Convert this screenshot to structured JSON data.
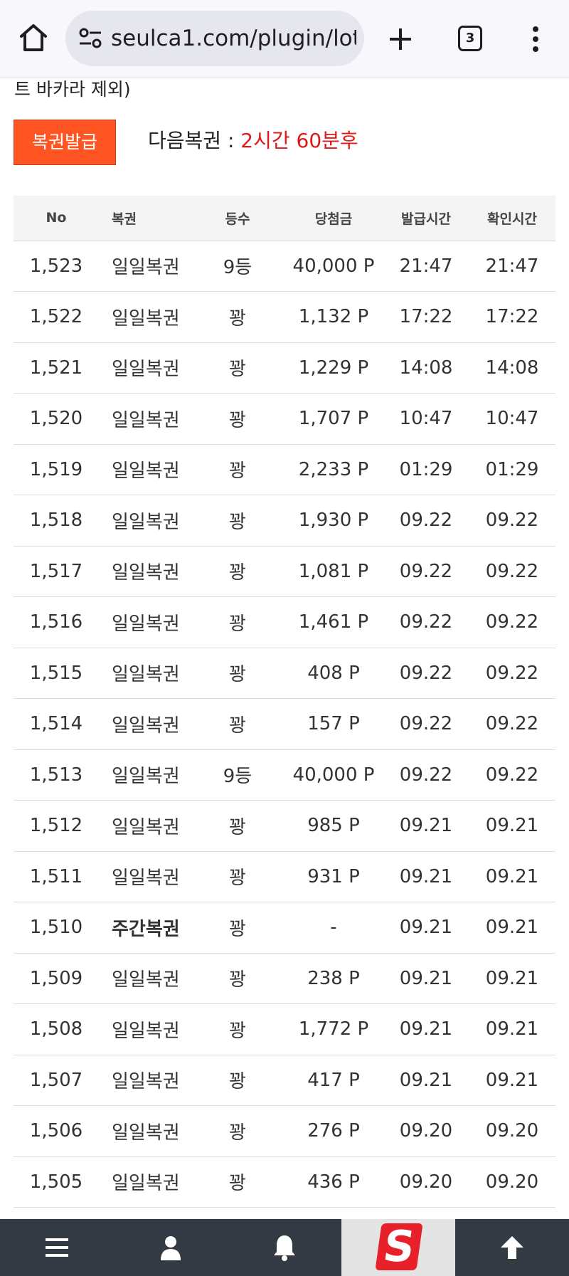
{
  "browser": {
    "url": "seulca1.com/plugin/lot",
    "tab_count": "3"
  },
  "page": {
    "notice_tail": "트 바카라 제외)",
    "issue_button": "복권발급",
    "next_label": "다음복권 : ",
    "next_value": "2시간 60분후"
  },
  "table": {
    "headers": [
      "No",
      "복권",
      "등수",
      "당첨금",
      "발급시간",
      "확인시간"
    ],
    "rows": [
      {
        "no": "1,523",
        "name": "일일복권",
        "rank": "9등",
        "prize": "40,000 P",
        "issued": "21:47",
        "checked": "21:47"
      },
      {
        "no": "1,522",
        "name": "일일복권",
        "rank": "꽝",
        "prize": "1,132 P",
        "issued": "17:22",
        "checked": "17:22"
      },
      {
        "no": "1,521",
        "name": "일일복권",
        "rank": "꽝",
        "prize": "1,229 P",
        "issued": "14:08",
        "checked": "14:08"
      },
      {
        "no": "1,520",
        "name": "일일복권",
        "rank": "꽝",
        "prize": "1,707 P",
        "issued": "10:47",
        "checked": "10:47"
      },
      {
        "no": "1,519",
        "name": "일일복권",
        "rank": "꽝",
        "prize": "2,233 P",
        "issued": "01:29",
        "checked": "01:29"
      },
      {
        "no": "1,518",
        "name": "일일복권",
        "rank": "꽝",
        "prize": "1,930 P",
        "issued": "09.22",
        "checked": "09.22"
      },
      {
        "no": "1,517",
        "name": "일일복권",
        "rank": "꽝",
        "prize": "1,081 P",
        "issued": "09.22",
        "checked": "09.22"
      },
      {
        "no": "1,516",
        "name": "일일복권",
        "rank": "꽝",
        "prize": "1,461 P",
        "issued": "09.22",
        "checked": "09.22"
      },
      {
        "no": "1,515",
        "name": "일일복권",
        "rank": "꽝",
        "prize": "408 P",
        "issued": "09.22",
        "checked": "09.22"
      },
      {
        "no": "1,514",
        "name": "일일복권",
        "rank": "꽝",
        "prize": "157 P",
        "issued": "09.22",
        "checked": "09.22"
      },
      {
        "no": "1,513",
        "name": "일일복권",
        "rank": "9등",
        "prize": "40,000 P",
        "issued": "09.22",
        "checked": "09.22"
      },
      {
        "no": "1,512",
        "name": "일일복권",
        "rank": "꽝",
        "prize": "985 P",
        "issued": "09.21",
        "checked": "09.21"
      },
      {
        "no": "1,511",
        "name": "일일복권",
        "rank": "꽝",
        "prize": "931 P",
        "issued": "09.21",
        "checked": "09.21"
      },
      {
        "no": "1,510",
        "name": "주간복권",
        "rank": "꽝",
        "prize": "-",
        "issued": "09.21",
        "checked": "09.21",
        "bold": true
      },
      {
        "no": "1,509",
        "name": "일일복권",
        "rank": "꽝",
        "prize": "238 P",
        "issued": "09.21",
        "checked": "09.21"
      },
      {
        "no": "1,508",
        "name": "일일복권",
        "rank": "꽝",
        "prize": "1,772 P",
        "issued": "09.21",
        "checked": "09.21"
      },
      {
        "no": "1,507",
        "name": "일일복권",
        "rank": "꽝",
        "prize": "417 P",
        "issued": "09.21",
        "checked": "09.21"
      },
      {
        "no": "1,506",
        "name": "일일복권",
        "rank": "꽝",
        "prize": "276 P",
        "issued": "09.20",
        "checked": "09.20"
      },
      {
        "no": "1,505",
        "name": "일일복권",
        "rank": "꽝",
        "prize": "436 P",
        "issued": "09.20",
        "checked": "09.20"
      }
    ]
  },
  "bottom_nav": {
    "items": [
      "menu-icon",
      "user-icon",
      "bell-icon",
      "site-logo",
      "arrow-up-icon"
    ],
    "logo_letter": "S"
  },
  "colors": {
    "accent": "#ff5522",
    "next_value": "#e01818",
    "nav_bg": "#343a44"
  }
}
